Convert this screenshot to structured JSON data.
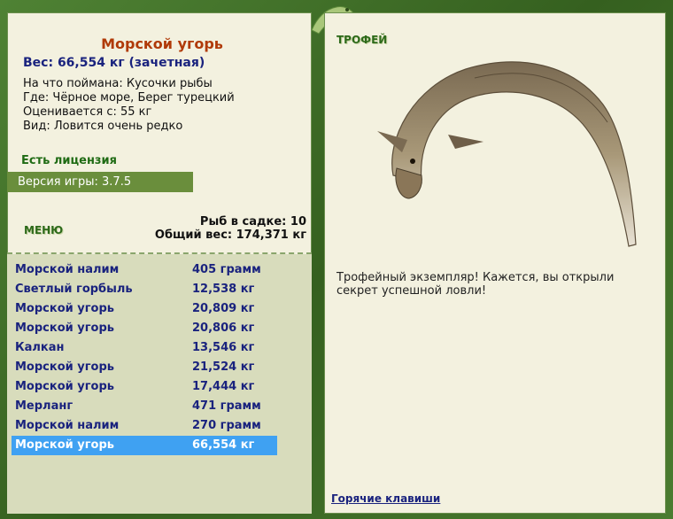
{
  "fish": {
    "title": "Морской угорь",
    "weight_line": "Вес: 66,554 кг (зачетная)",
    "bait": "На что поймана: Кусочки рыбы",
    "location": "Где: Чёрное море, Берег турецкий",
    "valued_from": "Оценивается с: 55 кг",
    "kind": "Вид: Ловится очень редко"
  },
  "license": "Есть лицензия",
  "version": "Версия игры: 3.7.5",
  "menu_label": "МЕНЮ",
  "keepnet": {
    "count": "Рыб в садке: 10",
    "total": "Общий вес: 174,371 кг"
  },
  "catches": [
    {
      "name": "Морской налим",
      "weight": "405 грамм"
    },
    {
      "name": "Светлый горбыль",
      "weight": "12,538 кг"
    },
    {
      "name": "Морской угорь",
      "weight": "20,809 кг"
    },
    {
      "name": "Морской угорь",
      "weight": "20,806 кг"
    },
    {
      "name": "Калкан",
      "weight": "13,546 кг"
    },
    {
      "name": "Морской угорь",
      "weight": "21,524 кг"
    },
    {
      "name": "Морской угорь",
      "weight": "17,444 кг"
    },
    {
      "name": "Мерланг",
      "weight": "471 грамм"
    },
    {
      "name": "Морской налим",
      "weight": "270 грамм"
    },
    {
      "name": "Морской угорь",
      "weight": "66,554 кг"
    }
  ],
  "selected_index": 9,
  "trophy": {
    "label": "ТРОФЕЙ",
    "text": "Трофейный экземпляр! Кажется, вы открыли секрет успешной ловли!",
    "image_icon": "eel-image"
  },
  "hotkeys": "Горячие клавиши",
  "colors": {
    "title": "#b03a08",
    "weight": "#1a237e",
    "selection": "#3fa1f2",
    "frame": "#3d6b2a"
  }
}
